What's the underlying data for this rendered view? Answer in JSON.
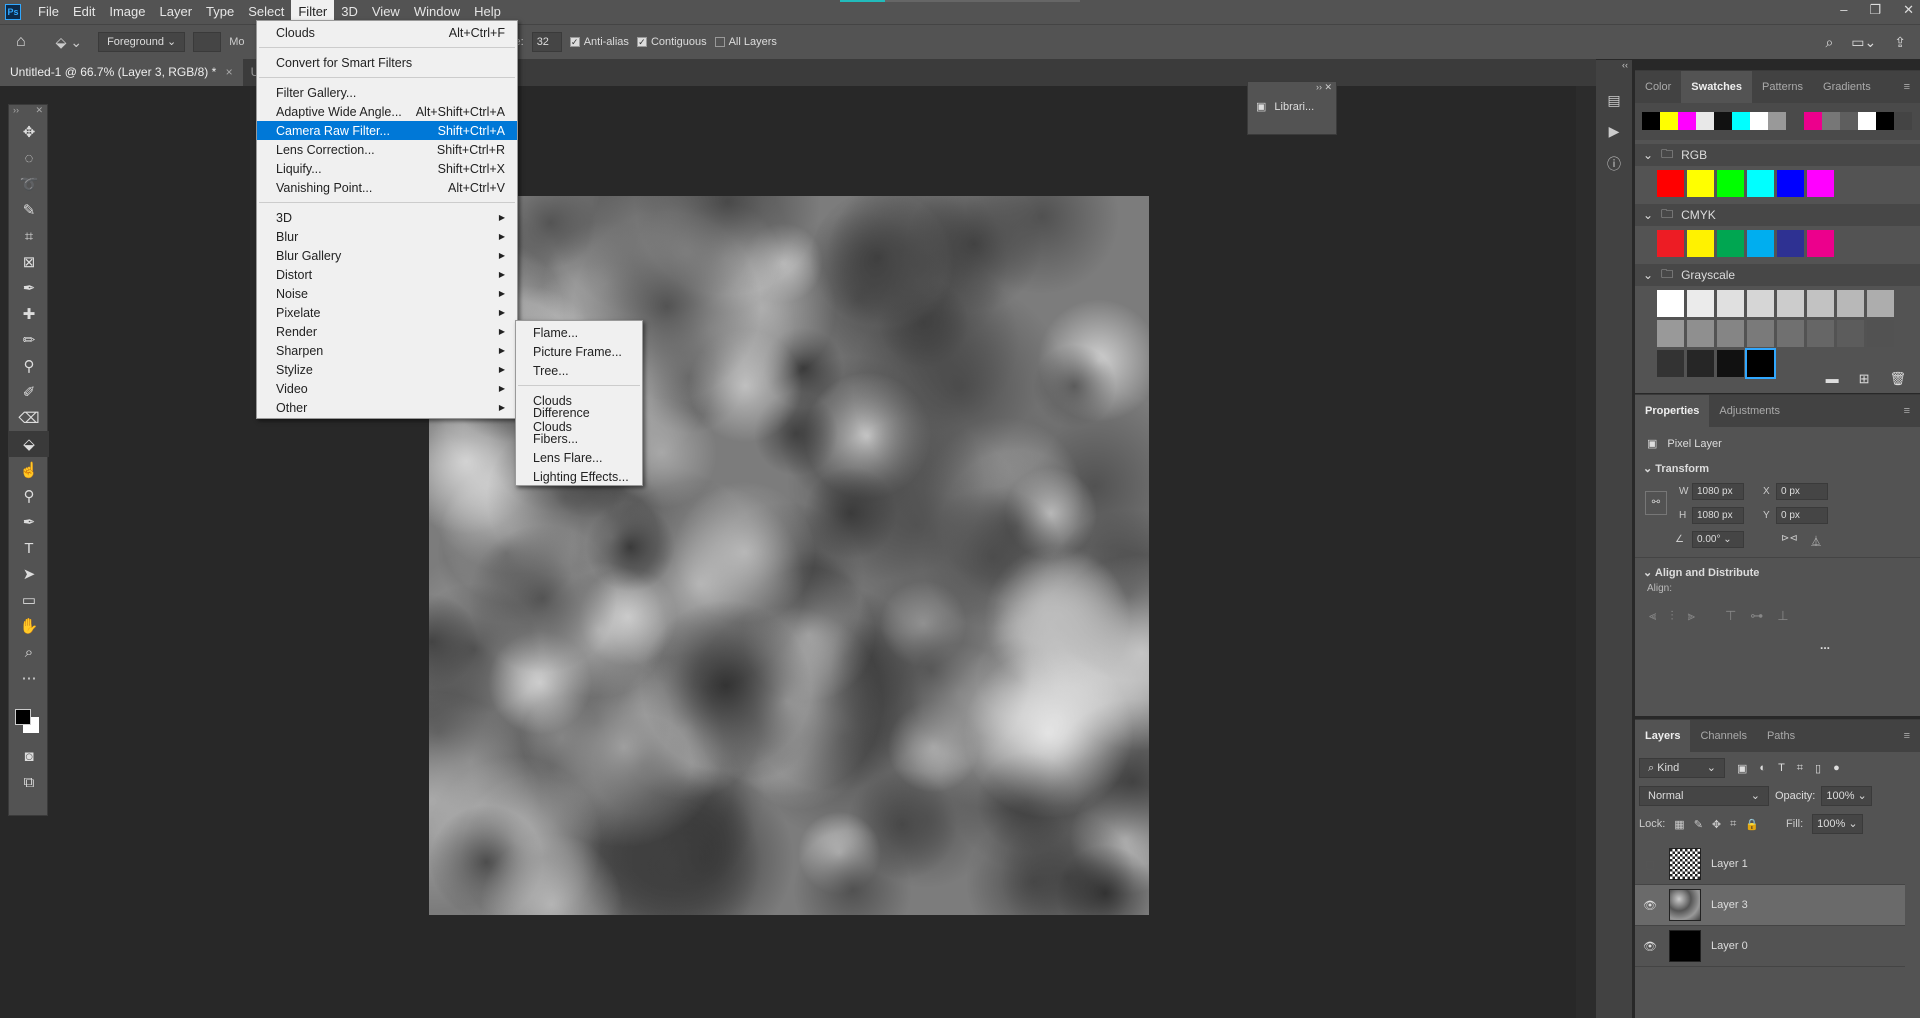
{
  "app": {
    "logo": "Ps",
    "menu": [
      "File",
      "Edit",
      "Image",
      "Layer",
      "Type",
      "Select",
      "Filter",
      "3D",
      "View",
      "Window",
      "Help"
    ],
    "active_menu": "Filter"
  },
  "options": {
    "fill_source": "Foreground",
    "mode_label": "Mo",
    "tolerance_label": "e:",
    "tolerance": "32",
    "anti_alias": "Anti-alias",
    "contiguous": "Contiguous",
    "all_layers": "All Layers"
  },
  "document_tabs": [
    {
      "title": "Untitled-1 @ 66.7% (Layer 3, RGB/8) *"
    },
    {
      "title": "Un"
    }
  ],
  "filter_menu": {
    "groups": [
      [
        {
          "label": "Clouds",
          "shortcut": "Alt+Ctrl+F"
        }
      ],
      [
        {
          "label": "Convert for Smart Filters",
          "shortcut": ""
        }
      ],
      [
        {
          "label": "Filter Gallery...",
          "shortcut": ""
        },
        {
          "label": "Adaptive Wide Angle...",
          "shortcut": "Alt+Shift+Ctrl+A"
        },
        {
          "label": "Camera Raw Filter...",
          "shortcut": "Shift+Ctrl+A",
          "highlighted": true
        },
        {
          "label": "Lens Correction...",
          "shortcut": "Shift+Ctrl+R"
        },
        {
          "label": "Liquify...",
          "shortcut": "Shift+Ctrl+X"
        },
        {
          "label": "Vanishing Point...",
          "shortcut": "Alt+Ctrl+V"
        }
      ],
      [
        {
          "label": "3D",
          "sub": true
        },
        {
          "label": "Blur",
          "sub": true
        },
        {
          "label": "Blur Gallery",
          "sub": true
        },
        {
          "label": "Distort",
          "sub": true
        },
        {
          "label": "Noise",
          "sub": true
        },
        {
          "label": "Pixelate",
          "sub": true
        },
        {
          "label": "Render",
          "sub": true
        },
        {
          "label": "Sharpen",
          "sub": true
        },
        {
          "label": "Stylize",
          "sub": true
        },
        {
          "label": "Video",
          "sub": true
        },
        {
          "label": "Other",
          "sub": true
        }
      ]
    ]
  },
  "render_submenu": {
    "groups": [
      [
        "Flame...",
        "Picture Frame...",
        "Tree..."
      ],
      [
        "Clouds",
        "Difference Clouds",
        "Fibers...",
        "Lens Flare...",
        "Lighting Effects..."
      ]
    ]
  },
  "libraries": {
    "label": "Librari..."
  },
  "swatches_panel": {
    "tabs": [
      "Color",
      "Swatches",
      "Patterns",
      "Gradients"
    ],
    "active": "Swatches",
    "recent": [
      "#000000",
      "#ffff00",
      "#ff00ff",
      "#e8e8e8",
      "#111111",
      "#00ffff",
      "#ffffff",
      "#999999",
      "#4a4a4a",
      "#ec008c",
      "#777777",
      "#5e5e5e",
      "#ffffff",
      "#000000",
      "#444444"
    ],
    "groups": [
      {
        "name": "RGB",
        "colors": [
          "#ff0000",
          "#ffff00",
          "#00ff00",
          "#00ffff",
          "#0000ff",
          "#ff00ff"
        ]
      },
      {
        "name": "CMYK",
        "colors": [
          "#ed1c24",
          "#fff200",
          "#00a651",
          "#00aeef",
          "#2e3192",
          "#ec008c"
        ]
      },
      {
        "name": "Grayscale",
        "colors": [
          "#ffffff",
          "#ebebeb",
          "#e0e0e0",
          "#d6d6d6",
          "#cccccc",
          "#c2c2c2",
          "#b8b8b8",
          "#adadad",
          "#999999",
          "#8f8f8f",
          "#858585",
          "#7a7a7a",
          "#707070",
          "#666666",
          "#5c5c5c",
          "#525252",
          "#333333",
          "#262626",
          "#111111",
          "#000000"
        ]
      }
    ]
  },
  "properties_panel": {
    "tabs": [
      "Properties",
      "Adjustments"
    ],
    "active": "Properties",
    "layer_type": "Pixel Layer",
    "transform_title": "Transform",
    "w_label": "W",
    "w": "1080 px",
    "h_label": "H",
    "h": "1080 px",
    "x_label": "X",
    "x": "0 px",
    "y_label": "Y",
    "y": "0 px",
    "angle": "0.00°",
    "align_title": "Align and Distribute",
    "align_label": "Align:",
    "more": "..."
  },
  "layers_panel": {
    "tabs": [
      "Layers",
      "Channels",
      "Paths"
    ],
    "active": "Layers",
    "filter": "Kind",
    "blend": "Normal",
    "opacity_label": "Opacity:",
    "opacity": "100%",
    "lock_label": "Lock:",
    "fill_label": "Fill:",
    "fill": "100%",
    "layers": [
      {
        "name": "Layer 1",
        "visible": false,
        "selected": false
      },
      {
        "name": "Layer 3",
        "visible": true,
        "selected": true
      },
      {
        "name": "Layer 0",
        "visible": true,
        "selected": false
      }
    ]
  }
}
